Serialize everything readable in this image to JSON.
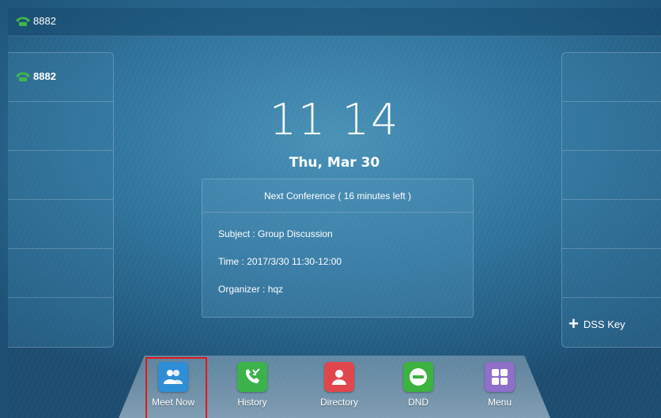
{
  "status_bar": {
    "account": "8882"
  },
  "line_keys": [
    {
      "label": "8882"
    },
    {
      "label": ""
    },
    {
      "label": ""
    },
    {
      "label": ""
    },
    {
      "label": ""
    },
    {
      "label": ""
    }
  ],
  "dss": {
    "add_label": "DSS Key"
  },
  "clock": {
    "time": "11 14",
    "date": "Thu, Mar 30"
  },
  "conference": {
    "header": "Next Conference ( 16 minutes left )",
    "subject": "Subject : Group Discussion",
    "time": "Time : 2017/3/30 11:30-12:00",
    "organizer": "Organizer : hqz"
  },
  "softkeys": [
    {
      "label": "Meet Now",
      "icon": "meet-now-icon",
      "color": "#2e8fd6"
    },
    {
      "label": "History",
      "icon": "history-icon",
      "color": "#3bb34a"
    },
    {
      "label": "Directory",
      "icon": "directory-icon",
      "color": "#e0474c"
    },
    {
      "label": "DND",
      "icon": "dnd-icon",
      "color": "#3cb23f"
    },
    {
      "label": "Menu",
      "icon": "menu-icon",
      "color": "#8e6fc9"
    }
  ],
  "colors": {
    "phone_icon": "#3fb84a",
    "selection_border": "#e2161b"
  }
}
